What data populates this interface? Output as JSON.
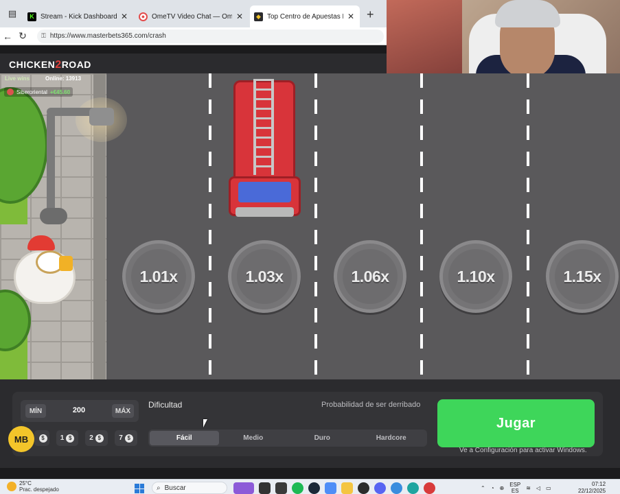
{
  "browser": {
    "tabs": [
      {
        "title": "Stream - Kick Dashboard",
        "favicon": "K",
        "color": "#53fc18"
      },
      {
        "title": "OmeTV Video Chat — Omegle",
        "favicon": "O",
        "color": "#e34b4b"
      },
      {
        "title": "Top Centro de Apuestas Deportivas",
        "favicon": "M",
        "color": "#f3c52a"
      }
    ],
    "url": "https://www.masterbets365.com/crash",
    "new_tab": "+"
  },
  "game": {
    "logo_left": "CHICKEN",
    "logo_num": "2",
    "logo_right": "ROAD",
    "live_wins": "Live wins",
    "online": "Online: 13913",
    "winner_name": "Siberoriental",
    "winner_amount": "+€45.60",
    "multipliers": [
      "1.01x",
      "1.03x",
      "1.06x",
      "1.10x",
      "1.15x"
    ]
  },
  "controls": {
    "min_label": "MÍN",
    "bet_value": "200",
    "max_label": "MÁX",
    "quick_bets": [
      "",
      "1",
      "2",
      "7"
    ],
    "coin_symbol": "$",
    "brand_badge": "MB",
    "difficulty_label": "Dificultad",
    "probability_label": "Probabilidad de ser derribado",
    "difficulty_options": [
      "Fácil",
      "Medio",
      "Duro",
      "Hardcore"
    ],
    "active_difficulty": "Fácil",
    "play_label": "Jugar",
    "activate_windows": "Ve a Configuración para activar Windows."
  },
  "taskbar": {
    "temperature": "25°C",
    "weather_desc": "Prac. despejado",
    "search_placeholder": "Buscar",
    "language": "ESP",
    "language_sub": "ES",
    "time": "07:12",
    "date": "22/12/2025"
  },
  "colors": {
    "play_button": "#3ed65a",
    "badge": "#f3c52a",
    "road": "#5a595b"
  }
}
